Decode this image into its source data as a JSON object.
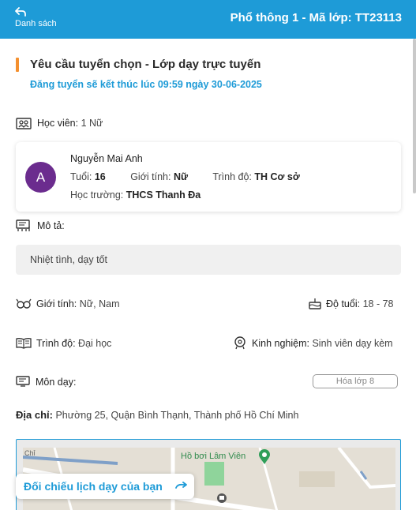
{
  "header": {
    "back_label": "Danh sách",
    "title": "Phổ thông 1 - Mã lớp: TT23113"
  },
  "post": {
    "title": "Yêu cầu tuyển chọn - Lớp dạy trực tuyến",
    "deadline": "Đăng tuyển sẽ kết thúc lúc 09:59 ngày 30-06-2025"
  },
  "student_section": {
    "label": "Học viên:",
    "value": "1 Nữ"
  },
  "student": {
    "avatar_letter": "A",
    "name": "Nguyễn Mai Anh",
    "age_label": "Tuổi:",
    "age": "16",
    "gender_label": "Giới tính:",
    "gender": "Nữ",
    "level_label": "Trình độ:",
    "level": "TH Cơ sở",
    "school_label": "Học trường:",
    "school": "THCS Thanh Đa"
  },
  "description": {
    "label": "Mô tả:",
    "text": "Nhiệt tình, dạy tốt"
  },
  "requirements": {
    "gender_label": "Giới tính:",
    "gender": "Nữ, Nam",
    "age_label": "Độ tuổi:",
    "age": "18 - 78",
    "level_label": "Trình độ:",
    "level": "Đại học",
    "experience_label": "Kinh nghiệm:",
    "experience": "Sinh viên dạy kèm"
  },
  "subject": {
    "label": "Môn dạy:",
    "tag": "Hóa lớp 8"
  },
  "address": {
    "label": "Địa chỉ:",
    "value": "Phường 25, Quận Bình Thạnh, Thành phố Hồ Chí Minh"
  },
  "map": {
    "poi_label": "Hồ bơi Lâm Viên",
    "street_fragment": "Chỉ"
  },
  "compare_button": {
    "label": "Đối chiếu lịch dạy của bạn"
  },
  "colors": {
    "primary": "#1e9bd7",
    "accent": "#f4902f",
    "avatar": "#6b2c8e"
  }
}
